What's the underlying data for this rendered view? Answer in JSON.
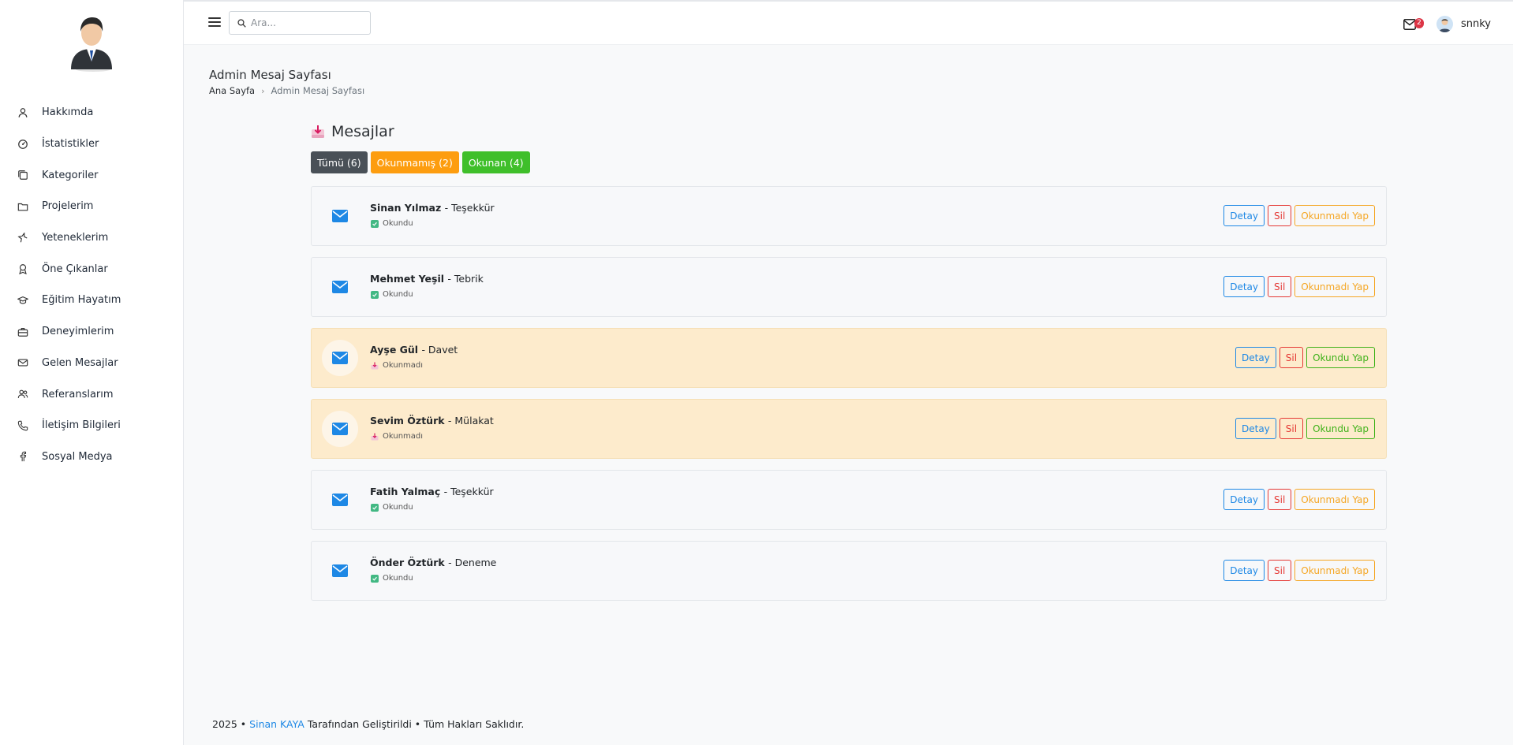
{
  "sidebar": {
    "items": [
      {
        "label": "Hakkımda",
        "icon": "user-icon"
      },
      {
        "label": "İstatistikler",
        "icon": "speedometer-icon"
      },
      {
        "label": "Kategoriler",
        "icon": "collection-icon"
      },
      {
        "label": "Projelerim",
        "icon": "folder-icon"
      },
      {
        "label": "Yeteneklerim",
        "icon": "star-icon"
      },
      {
        "label": "Öne Çıkanlar",
        "icon": "award-icon"
      },
      {
        "label": "Eğitim Hayatım",
        "icon": "mortarboard-icon"
      },
      {
        "label": "Deneyimlerim",
        "icon": "briefcase-icon"
      },
      {
        "label": "Gelen Mesajlar",
        "icon": "envelope-icon"
      },
      {
        "label": "Referanslarım",
        "icon": "people-icon"
      },
      {
        "label": "İletişim Bilgileri",
        "icon": "phone-icon"
      },
      {
        "label": "Sosyal Medya",
        "icon": "facebook-icon"
      }
    ]
  },
  "topbar": {
    "search_placeholder": "Ara...",
    "mail_badge": "2",
    "username": "snnky"
  },
  "page": {
    "title": "Admin Mesaj Sayfası",
    "breadcrumb_home": "Ana Sayfa",
    "breadcrumb_sep": "›",
    "breadcrumb_current": "Admin Mesaj Sayfası"
  },
  "messages_panel": {
    "title": "Mesajlar",
    "filters": {
      "all": "Tümü (6)",
      "unread": "Okunmamış (2)",
      "read": "Okunan (4)"
    },
    "detail_label": "Detay",
    "delete_label": "Sil",
    "mark_unread_label": "Okunmadı Yap",
    "mark_read_label": "Okundu Yap",
    "items": [
      {
        "sender": "Sinan Yılmaz",
        "subject": "- Teşekkür",
        "status": "Okundu",
        "read": true
      },
      {
        "sender": "Mehmet Yeşil",
        "subject": "- Tebrik",
        "status": "Okundu",
        "read": true
      },
      {
        "sender": "Ayşe Gül",
        "subject": "- Davet",
        "status": "Okunmadı",
        "read": false
      },
      {
        "sender": "Sevim Öztürk",
        "subject": "- Mülakat",
        "status": "Okunmadı",
        "read": false
      },
      {
        "sender": "Fatih Yalmaç",
        "subject": "- Teşekkür",
        "status": "Okundu",
        "read": true
      },
      {
        "sender": "Önder Öztürk",
        "subject": "- Deneme",
        "status": "Okundu",
        "read": true
      }
    ]
  },
  "footer": {
    "year": "2025 •",
    "author": "Sinan KAYA",
    "text": "Tarafından Geliştirildi • Tüm Hakları Saklıdır."
  },
  "colors": {
    "accent": "#1e88e5",
    "unread_bg": "#fdebcc",
    "filter_all": "#495057",
    "filter_unread": "#fd9d0f",
    "filter_read": "#3fbf2a"
  }
}
